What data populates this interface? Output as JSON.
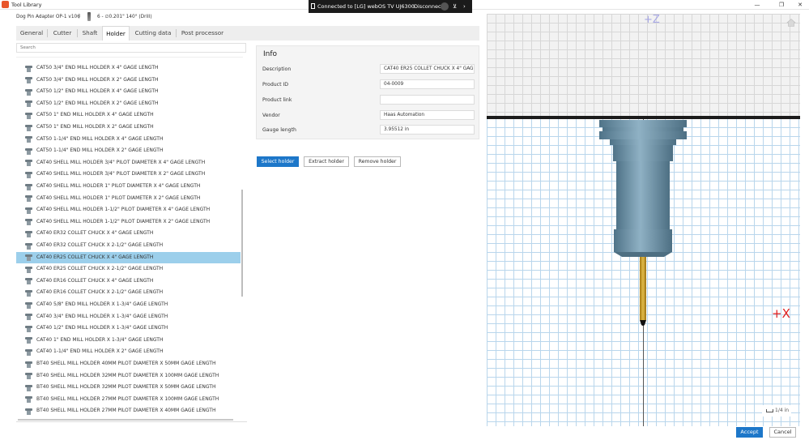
{
  "window": {
    "title": "Tool Library",
    "minimize": "—",
    "restore": "❐",
    "close": "✕"
  },
  "cast_banner": {
    "text": "Connected to [LG] webOS TV UJ6300 Ch",
    "disconnect": "Disconnect",
    "pin": "⊻",
    "more": "›"
  },
  "breadcrumb": {
    "library": "Dog Pin Adapter OP-1 v106",
    "separator": "/",
    "tool": "6 - ∅0.201\" 140° (Drill)"
  },
  "tabs": [
    "General",
    "Cutter",
    "Shaft",
    "Holder",
    "Cutting data",
    "Post processor"
  ],
  "active_tab": "Holder",
  "search": {
    "placeholder": "Search"
  },
  "holders": [
    "CAT50 3/4\" END MILL HOLDER X 4\" GAGE LENGTH",
    "CAT50 3/4\" END MILL HOLDER X 2\" GAGE LENGTH",
    "CAT50 1/2\" END MILL HOLDER X 4\" GAGE LENGTH",
    "CAT50 1/2\" END MILL HOLDER X 2\" GAGE LENGTH",
    "CAT50 1\" END MILL HOLDER X 4\" GAGE LENGTH",
    "CAT50 1\" END MILL HOLDER X 2\" GAGE LENGTH",
    "CAT50 1-1/4\" END MILL HOLDER X 4\" GAGE LENGTH",
    "CAT50 1-1/4\" END MILL HOLDER X 2\" GAGE LENGTH",
    "CAT40 SHELL MILL HOLDER 3/4\" PILOT DIAMETER X 4\" GAGE LENGTH",
    "CAT40 SHELL MILL HOLDER 3/4\" PILOT DIAMETER X 2\" GAGE LENGTH",
    "CAT40 SHELL MILL HOLDER 1\" PILOT DIAMETER X 4\" GAGE LENGTH",
    "CAT40 SHELL MILL HOLDER 1\" PILOT DIAMETER X 2\" GAGE LENGTH",
    "CAT40 SHELL MILL HOLDER 1-1/2\" PILOT DIAMETER X 4\" GAGE LENGTH",
    "CAT40 SHELL MILL HOLDER 1-1/2\" PILOT DIAMETER X 2\" GAGE LENGTH",
    "CAT40 ER32 COLLET CHUCK X 4\" GAGE LENGTH",
    "CAT40 ER32 COLLET CHUCK X 2-1/2\" GAGE LENGTH",
    "CAT40 ER25 COLLET CHUCK X 4\" GAGE LENGTH",
    "CAT40 ER25 COLLET CHUCK X 2-1/2\" GAGE LENGTH",
    "CAT40 ER16 COLLET CHUCK X 4\" GAGE LENGTH",
    "CAT40 ER16 COLLET CHUCK X 2-1/2\" GAGE LENGTH",
    "CAT40 5/8\" END MILL HOLDER X 1-3/4\" GAGE LENGTH",
    "CAT40 3/4\" END MILL HOLDER X 1-3/4\" GAGE LENGTH",
    "CAT40 1/2\" END MILL HOLDER X 1-3/4\" GAGE LENGTH",
    "CAT40 1\" END MILL HOLDER X 1-3/4\" GAGE LENGTH",
    "CAT40 1-1/4\" END MILL HOLDER X 2\" GAGE LENGTH",
    "BT40 SHELL MILL HOLDER 40MM PILOT DIAMETER X 50MM GAGE LENGTH",
    "BT40 SHELL MILL HOLDER 32MM PILOT DIAMETER X 100MM GAGE LENGTH",
    "BT40 SHELL MILL HOLDER 32MM PILOT DIAMETER X 50MM GAGE LENGTH",
    "BT40 SHELL MILL HOLDER 27MM PILOT DIAMETER X 100MM GAGE LENGTH",
    "BT40 SHELL MILL HOLDER 27MM PILOT DIAMETER X 40MM GAGE LENGTH"
  ],
  "selected_holder": "CAT40 ER25 COLLET CHUCK X 4\" GAGE LENGTH",
  "info": {
    "title": "Info",
    "description_label": "Description",
    "description": "CAT40 ER25 COLLET CHUCK X 4\" GAG",
    "product_id_label": "Product ID",
    "product_id": "04-0009",
    "product_link_label": "Product link",
    "product_link": "",
    "vendor_label": "Vendor",
    "vendor": "Haas Automation",
    "gauge_length_label": "Gauge length",
    "gauge_length": "3.95512 in"
  },
  "holder_buttons": {
    "select": "Select holder",
    "extract": "Extract holder",
    "remove": "Remove holder"
  },
  "preview": {
    "z_axis": "+Z",
    "x_axis": "+X",
    "scale": "1/4 in"
  },
  "footer": {
    "accept": "Accept",
    "cancel": "Cancel"
  },
  "colors": {
    "accent": "#1d77c9",
    "selection": "#9ccfeb",
    "holder_body": "#6f93a6",
    "drill_shank": "#c79a26"
  }
}
